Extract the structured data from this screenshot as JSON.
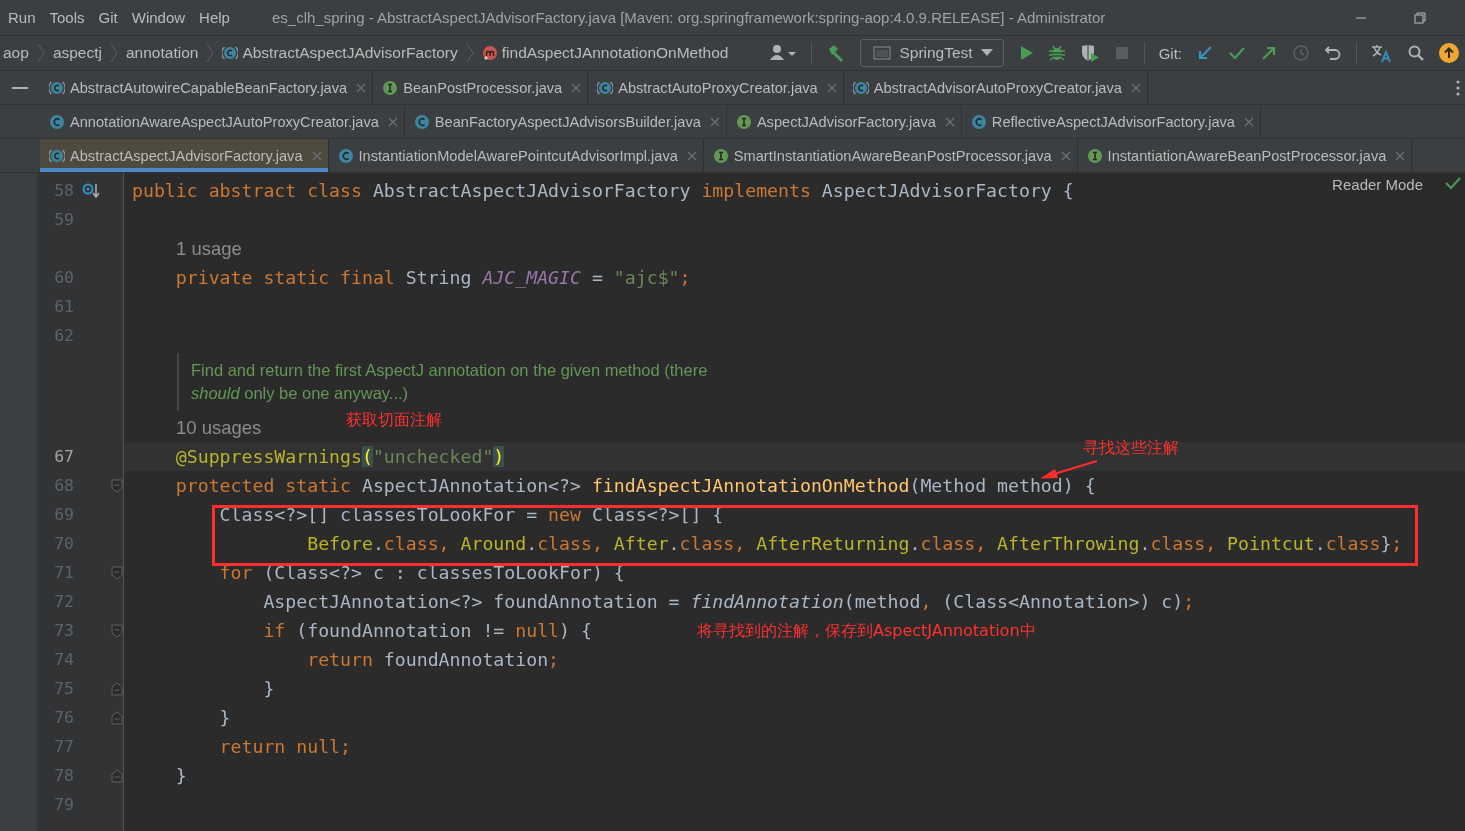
{
  "menu": [
    {
      "label": "Run"
    },
    {
      "label": "Tools"
    },
    {
      "label": "Git"
    },
    {
      "label": "Window"
    },
    {
      "label": "Help"
    }
  ],
  "window": {
    "title": "es_clh_spring - AbstractAspectJAdvisorFactory.java [Maven: org.springframework:spring-aop:4.0.9.RELEASE] - Administrator"
  },
  "breadcrumbs": [
    {
      "label": "aop",
      "kind": "folder"
    },
    {
      "label": "aspectj",
      "kind": "folder"
    },
    {
      "label": "annotation",
      "kind": "folder"
    },
    {
      "label": "AbstractAspectJAdvisorFactory",
      "kind": "abstract"
    },
    {
      "label": "findAspectJAnnotationOnMethod",
      "kind": "method"
    }
  ],
  "toolbar": {
    "run_config": "SpringTest",
    "git_label": "Git:"
  },
  "tab_rows": [
    [
      {
        "label": "AbstractAutowireCapableBeanFactory.java",
        "kind": "abstract",
        "selected": false
      },
      {
        "label": "BeanPostProcessor.java",
        "kind": "interface",
        "selected": false
      },
      {
        "label": "AbstractAutoProxyCreator.java",
        "kind": "abstract",
        "selected": false
      },
      {
        "label": "AbstractAdvisorAutoProxyCreator.java",
        "kind": "abstract",
        "selected": false
      }
    ],
    [
      {
        "label": "AnnotationAwareAspectJAutoProxyCreator.java",
        "kind": "class",
        "selected": false
      },
      {
        "label": "BeanFactoryAspectJAdvisorsBuilder.java",
        "kind": "class",
        "selected": false
      },
      {
        "label": "AspectJAdvisorFactory.java",
        "kind": "interface",
        "selected": false
      },
      {
        "label": "ReflectiveAspectJAdvisorFactory.java",
        "kind": "class",
        "selected": false
      }
    ],
    [
      {
        "label": "AbstractAspectJAdvisorFactory.java",
        "kind": "abstract",
        "selected": true
      },
      {
        "label": "InstantiationModelAwarePointcutAdvisorImpl.java",
        "kind": "class",
        "selected": false
      },
      {
        "label": "SmartInstantiationAwareBeanPostProcessor.java",
        "kind": "interface",
        "selected": false
      },
      {
        "label": "InstantiationAwareBeanPostProcessor.java",
        "kind": "interface",
        "selected": false
      }
    ]
  ],
  "editor": {
    "reader_mode": "Reader Mode",
    "lines": [
      {
        "kind": "code",
        "number": "58",
        "implemented_marker": true,
        "current": false,
        "tokens": [
          {
            "kind": "keyword",
            "text": "public abstract class "
          },
          {
            "kind": "plain",
            "text": "AbstractAspectJAdvisorFactory "
          },
          {
            "kind": "keyword",
            "text": "implements "
          },
          {
            "kind": "plain",
            "text": "AspectJAdvisorFactory {"
          }
        ]
      },
      {
        "kind": "code",
        "number": "59",
        "current": false
      },
      {
        "kind": "hint",
        "text": "1 usage"
      },
      {
        "kind": "code",
        "number": "60",
        "current": false,
        "tokens": [
          {
            "kind": "keyword",
            "text": "    private static final "
          },
          {
            "kind": "plain",
            "text": "String "
          },
          {
            "kind": "constant",
            "text": "AJC_MAGIC"
          },
          {
            "kind": "plain",
            "text": " = "
          },
          {
            "kind": "string",
            "text": "\"ajc$\""
          },
          {
            "kind": "keyword",
            "text": ";"
          }
        ]
      },
      {
        "kind": "code",
        "number": "61",
        "current": false
      },
      {
        "kind": "code",
        "number": "62",
        "current": false
      },
      {
        "kind": "doc",
        "lines": [
          "Find and return the first AspectJ annotation on the given method (there",
          "*should* only be one anyway...)"
        ]
      },
      {
        "kind": "hint",
        "text": "10 usages"
      },
      {
        "kind": "code",
        "number": "67",
        "current": true,
        "tokens": [
          {
            "kind": "annotation",
            "text": "    @SuppressWarnings"
          },
          {
            "kind": "brace_match",
            "text": "("
          },
          {
            "kind": "string",
            "text": "\"unchecked\""
          },
          {
            "kind": "brace_match",
            "text": ")"
          }
        ]
      },
      {
        "kind": "code",
        "number": "68",
        "fold_open": true,
        "current": false,
        "tokens": [
          {
            "kind": "keyword",
            "text": "    protected static "
          },
          {
            "kind": "plain",
            "text": "AspectJAnnotation<?> "
          },
          {
            "kind": "method_decl",
            "text": "findAspectJAnnotationOnMethod"
          },
          {
            "kind": "plain",
            "text": "(Method method) {"
          }
        ]
      },
      {
        "kind": "code",
        "number": "69",
        "current": false,
        "tokens": [
          {
            "kind": "plain",
            "text": "        Class<?>[] classesToLookFor = "
          },
          {
            "kind": "keyword",
            "text": "new "
          },
          {
            "kind": "plain",
            "text": "Class<?>[] {"
          }
        ]
      },
      {
        "kind": "code",
        "number": "70",
        "current": false,
        "tokens": [
          {
            "kind": "annotation",
            "text": "                Before"
          },
          {
            "kind": "plain",
            "text": "."
          },
          {
            "kind": "keyword",
            "text": "class, "
          },
          {
            "kind": "annotation",
            "text": "Around"
          },
          {
            "kind": "plain",
            "text": "."
          },
          {
            "kind": "keyword",
            "text": "class, "
          },
          {
            "kind": "annotation",
            "text": "After"
          },
          {
            "kind": "plain",
            "text": "."
          },
          {
            "kind": "keyword",
            "text": "class, "
          },
          {
            "kind": "annotation",
            "text": "AfterReturning"
          },
          {
            "kind": "plain",
            "text": "."
          },
          {
            "kind": "keyword",
            "text": "class, "
          },
          {
            "kind": "annotation",
            "text": "AfterThrowing"
          },
          {
            "kind": "plain",
            "text": "."
          },
          {
            "kind": "keyword",
            "text": "class, "
          },
          {
            "kind": "annotation",
            "text": "Pointcut"
          },
          {
            "kind": "plain",
            "text": "."
          },
          {
            "kind": "keyword",
            "text": "class"
          },
          {
            "kind": "plain",
            "text": "}"
          },
          {
            "kind": "keyword",
            "text": ";"
          }
        ]
      },
      {
        "kind": "code",
        "number": "71",
        "fold_open": true,
        "current": false,
        "tokens": [
          {
            "kind": "keyword",
            "text": "        for "
          },
          {
            "kind": "plain",
            "text": "(Class<?> c : classesToLookFor) {"
          }
        ]
      },
      {
        "kind": "code",
        "number": "72",
        "current": false,
        "tokens": [
          {
            "kind": "plain",
            "text": "            AspectJAnnotation<?> foundAnnotation = "
          },
          {
            "kind": "static_call",
            "text": "findAnnotation"
          },
          {
            "kind": "plain",
            "text": "(method"
          },
          {
            "kind": "keyword",
            "text": ", "
          },
          {
            "kind": "plain",
            "text": "(Class<Annotation>) c)"
          },
          {
            "kind": "keyword",
            "text": ";"
          }
        ]
      },
      {
        "kind": "code",
        "number": "73",
        "fold_open": true,
        "current": false,
        "tokens": [
          {
            "kind": "keyword",
            "text": "            if "
          },
          {
            "kind": "plain",
            "text": "(foundAnnotation != "
          },
          {
            "kind": "keyword",
            "text": "null"
          },
          {
            "kind": "plain",
            "text": ") {"
          }
        ]
      },
      {
        "kind": "code",
        "number": "74",
        "current": false,
        "tokens": [
          {
            "kind": "keyword",
            "text": "                return "
          },
          {
            "kind": "plain",
            "text": "foundAnnotation"
          },
          {
            "kind": "keyword",
            "text": ";"
          }
        ]
      },
      {
        "kind": "code",
        "number": "75",
        "fold_close": true,
        "current": false,
        "tokens": [
          {
            "kind": "plain",
            "text": "            }"
          }
        ]
      },
      {
        "kind": "code",
        "number": "76",
        "fold_close": true,
        "current": false,
        "tokens": [
          {
            "kind": "plain",
            "text": "        }"
          }
        ]
      },
      {
        "kind": "code",
        "number": "77",
        "current": false,
        "tokens": [
          {
            "kind": "keyword",
            "text": "        return null;"
          }
        ]
      },
      {
        "kind": "code",
        "number": "78",
        "fold_close": true,
        "current": false,
        "tokens": [
          {
            "kind": "plain",
            "text": "    }"
          }
        ]
      },
      {
        "kind": "code",
        "number": "79",
        "current": false
      }
    ],
    "notes": [
      {
        "kind": "text",
        "text": "获取切面注解"
      },
      {
        "kind": "text",
        "text": "寻找这些注解"
      },
      {
        "kind": "arrow"
      },
      {
        "kind": "box"
      },
      {
        "kind": "text",
        "text": "将寻找到的注解，保存到AspectJAnnotation中"
      }
    ]
  }
}
